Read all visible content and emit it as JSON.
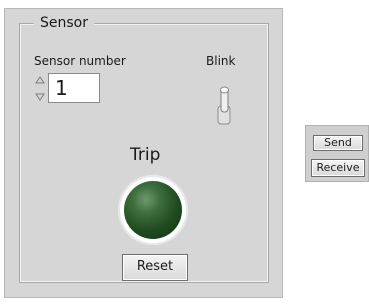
{
  "sensor_group": {
    "title": "Sensor",
    "sensor_number": {
      "label": "Sensor number",
      "value": "1"
    },
    "blink": {
      "label": "Blink"
    },
    "trip": {
      "label": "Trip",
      "led_color": "#2f5f2f",
      "state": "off"
    },
    "reset_button": {
      "label": "Reset"
    }
  },
  "comms": {
    "send_button": {
      "label": "Send"
    },
    "receive_button": {
      "label": "Receive"
    }
  }
}
